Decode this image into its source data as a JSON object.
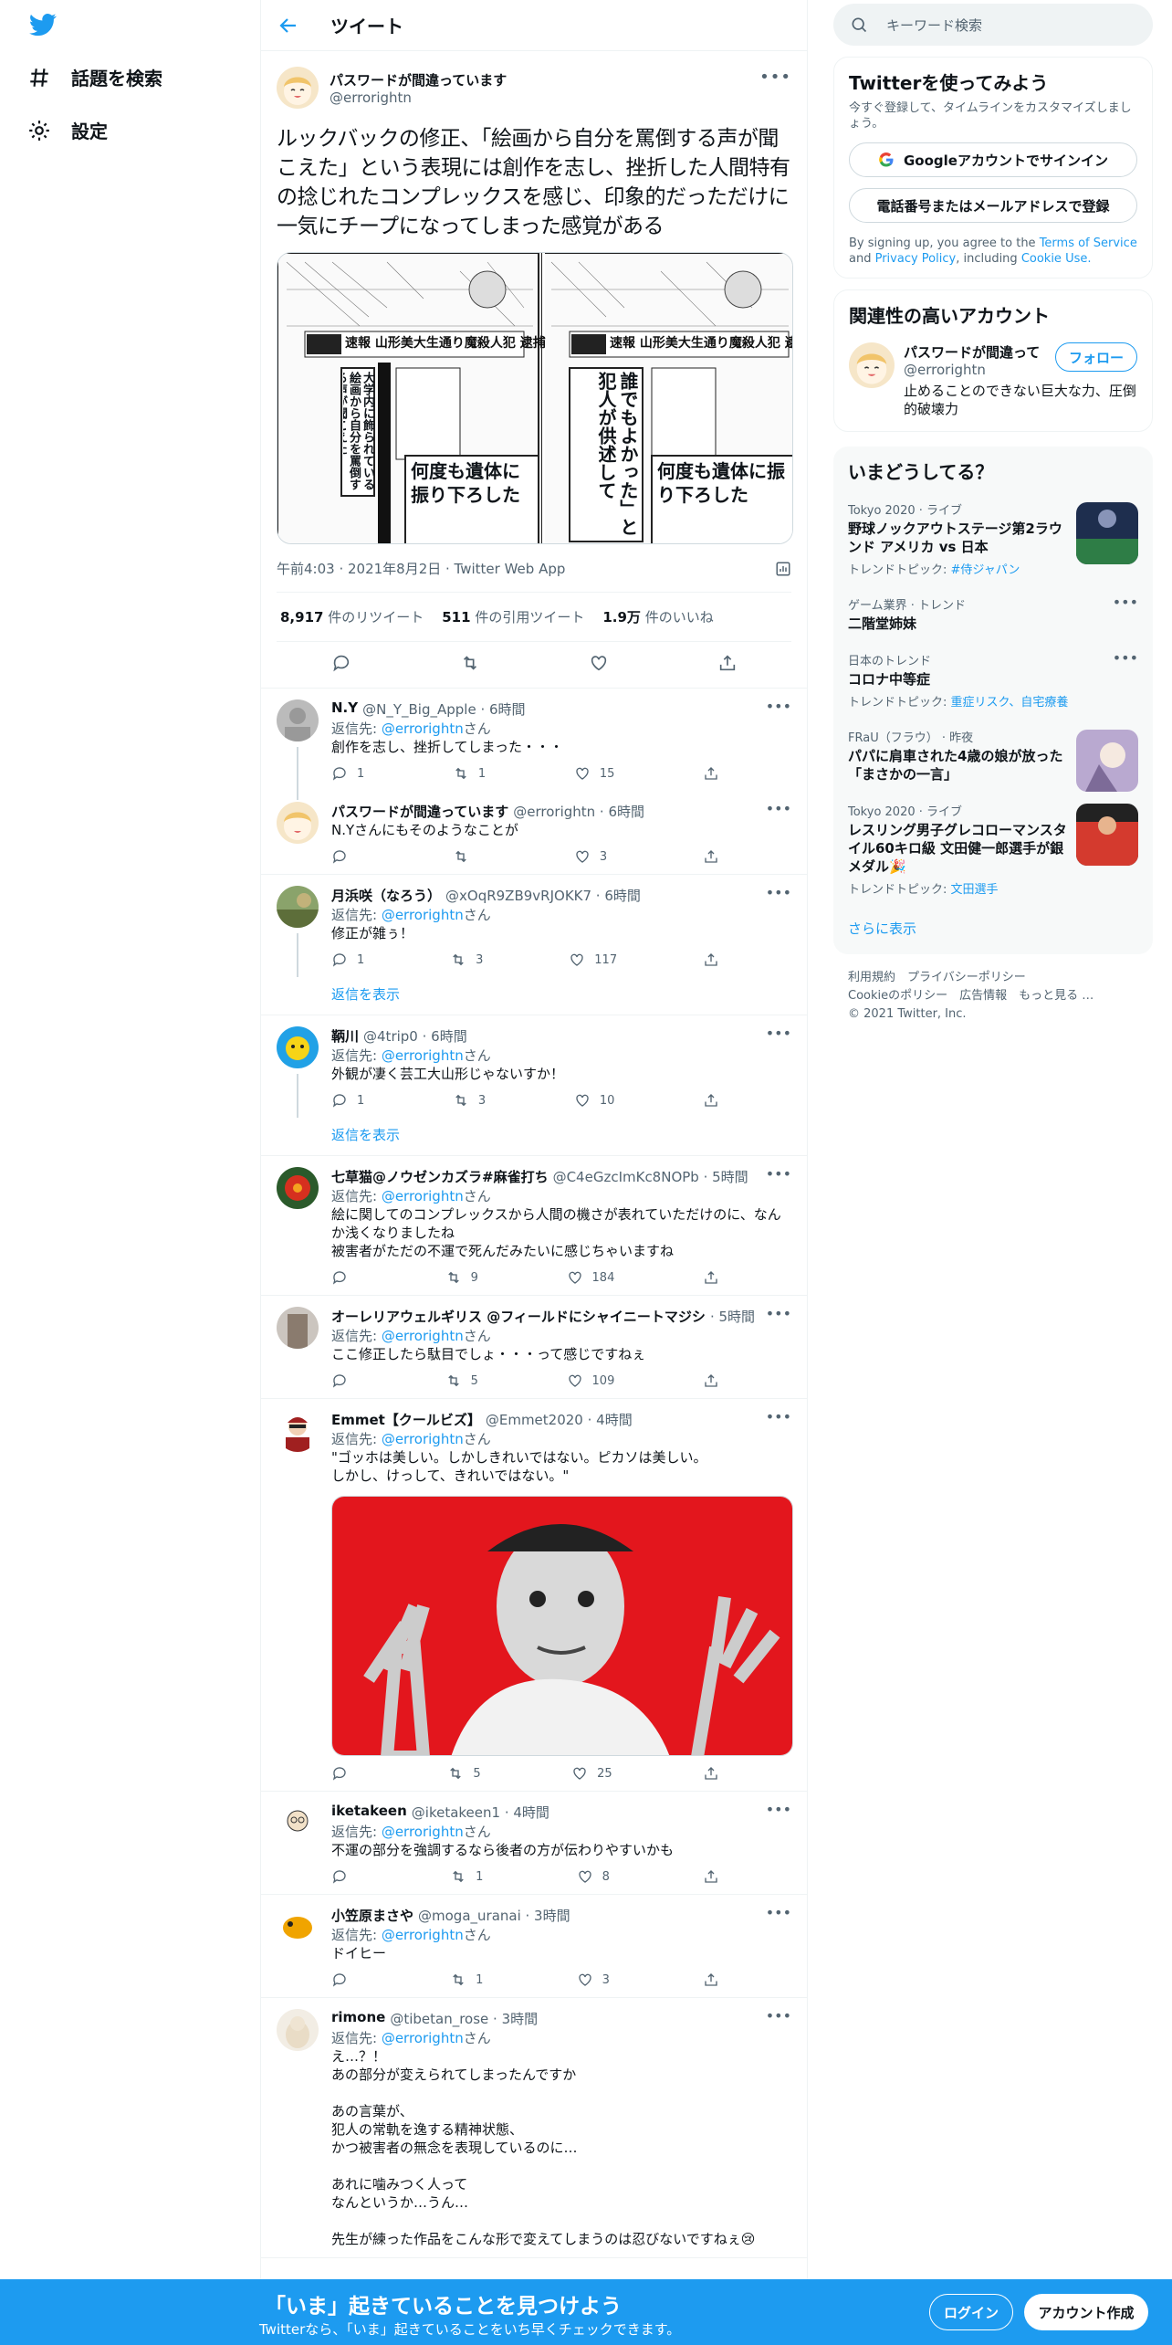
{
  "nav": {
    "explore": "話題を検索",
    "settings": "設定"
  },
  "header": {
    "title": "ツイート"
  },
  "tweet": {
    "author_name": "パスワードが間違っています",
    "author_handle": "@errorightn",
    "text": "ルックバックの修正、「絵画から自分を罵倒する声が聞こえた」という表現には創作を志し、挫折した人間特有の捻じれたコンプレックスを感じ、印象的だっただけに一気にチープになってしまった感覚がある",
    "media_caption_left": "速報 山形美大生通り魔殺人犯 逮捕",
    "media_caption_right": "速報 山形美大生通り魔殺人犯 逮捕",
    "media_quote_left": "大学内に飾られている絵画から自分を罵倒する声が聞こえた",
    "media_quote_right": "誰でもよかった」と犯人が供述して",
    "media_text_bottom": "何度も遺体に振り下ろした",
    "time": "午前4:03 · 2021年8月2日 · Twitter Web App",
    "retweets": "8,917",
    "retweets_label": "件のリツイート",
    "quotes": "511",
    "quotes_label": "件の引用ツイート",
    "likes": "1.9万",
    "likes_label": "件のいいね"
  },
  "replies": [
    {
      "name": "N.Y",
      "handle": "@N_Y_Big_Apple · 6時間",
      "reply_to": "@errorightn",
      "reply_prefix": "返信先: ",
      "reply_suffix": "さん",
      "text": "創作を志し、挫折してしまった・・・",
      "reply_count": "1",
      "rt_count": "1",
      "like_count": "15"
    },
    {
      "name": "パスワードが間違っています",
      "handle": "@errorightn · 6時間",
      "text": "N.Yさんにもそのようなことが",
      "reply_count": "",
      "rt_count": "",
      "like_count": "3"
    },
    {
      "name": "月浜咲（なろう）",
      "handle": "@xOqR9ZB9vRJOKK7 · 6時間",
      "reply_to": "@errorightn",
      "reply_prefix": "返信先: ",
      "reply_suffix": "さん",
      "text": "修正が雑ぅ！",
      "reply_count": "1",
      "rt_count": "3",
      "like_count": "117"
    },
    {
      "name": "鞆川",
      "handle": "@4trip0 · 6時間",
      "reply_to": "@errorightn",
      "reply_prefix": "返信先: ",
      "reply_suffix": "さん",
      "text": "外観が凄く芸工大山形じゃないすか！",
      "reply_count": "1",
      "rt_count": "3",
      "like_count": "10"
    },
    {
      "name": "七草猫@ノウゼンカズラ#麻雀打ち",
      "handle": "@C4eGzcImKc8NOPb · 5時間",
      "reply_to": "@errorightn",
      "reply_prefix": "返信先: ",
      "reply_suffix": "さん",
      "text": "絵に関してのコンプレックスから人間の機さが表れていただけのに、なんか浅くなりましたね\n被害者がただの不運で死んだみたいに感じちゃいますね",
      "reply_count": "",
      "rt_count": "9",
      "like_count": "184"
    },
    {
      "name": "オーレリアウェルギリス @フィールドにシャイニートマジシ",
      "handle": "· 5時間",
      "reply_to": "@errorightn",
      "reply_prefix": "返信先: ",
      "reply_suffix": "さん",
      "text": "ここ修正したら駄目でしょ・・・って感じですねぇ",
      "reply_count": "",
      "rt_count": "5",
      "like_count": "109"
    },
    {
      "name": "Emmet【クールビズ】",
      "handle": "@Emmet2020 · 4時間",
      "reply_to": "@errorightn",
      "reply_prefix": "返信先: ",
      "reply_suffix": "さん",
      "text": "\"ゴッホは美しい。しかしきれいではない。ピカソは美しい。\nしかし、けっして、きれいではない。\"",
      "reply_count": "",
      "rt_count": "5",
      "like_count": "25"
    },
    {
      "name": "iketakeen",
      "handle": "@iketakeen1 · 4時間",
      "reply_to": "@errorightn",
      "reply_prefix": "返信先: ",
      "reply_suffix": "さん",
      "text": "不運の部分を強調するなら後者の方が伝わりやすいかも",
      "reply_count": "",
      "rt_count": "1",
      "like_count": "8"
    },
    {
      "name": "小笠原まさや",
      "handle": "@moga_uranai · 3時間",
      "reply_to": "@errorightn",
      "reply_prefix": "返信先: ",
      "reply_suffix": "さん",
      "text": "ドイヒー",
      "reply_count": "",
      "rt_count": "1",
      "like_count": "3"
    },
    {
      "name": "rimone",
      "handle": "@tibetan_rose · 3時間",
      "reply_to": "@errorightn",
      "reply_prefix": "返信先: ",
      "reply_suffix": "さん",
      "text": "え…？！\nあの部分が変えられてしまったんですか\n\nあの言葉が、\n犯人の常軌を逸する精神状態、\nかつ被害者の無念を表現しているのに…\n\nあれに噛みつく人って\nなんというか…うん…\n\n先生が練った作品をこんな形で変えてしまうのは忍びないですねぇ😢"
    }
  ],
  "show_replies": "返信を表示",
  "search": {
    "placeholder": "キーワード検索"
  },
  "signup": {
    "title": "Twitterを使ってみよう",
    "sub": "今すぐ登録して、タイムラインをカスタマイズしましょう。",
    "google": "Googleアカウントでサインイン",
    "phone": "電話番号またはメールアドレスで登録",
    "fine1": "By signing up, you agree to the ",
    "terms": "Terms of Service",
    "fine2": " and ",
    "privacy": "Privacy Policy",
    "fine3": ", including ",
    "cookie": "Cookie Use."
  },
  "related": {
    "title": "関連性の高いアカウント",
    "name": "パスワードが間違って",
    "handle": "@errorightn",
    "follow": "フォロー",
    "bio": "止めることのできない巨大な力、圧倒的破壊力"
  },
  "trends": {
    "title": "いまどうしてる？",
    "items": [
      {
        "cat": "Tokyo 2020 · ライブ",
        "name": "野球ノックアウトステージ第2ラウンド アメリカ vs 日本",
        "topic_label": "トレンドトピック: ",
        "topic": "#侍ジャパン"
      },
      {
        "cat": "ゲーム業界 · トレンド",
        "name": "二階堂姉妹"
      },
      {
        "cat": "日本のトレンド",
        "name": "コロナ中等症",
        "topic_label": "トレンドトピック: ",
        "topic": "重症リスク、自宅療養"
      },
      {
        "cat": "FRaU（フラウ） · 昨夜",
        "name": "パパに肩車された4歳の娘が放った「まさかの一言」"
      },
      {
        "cat": "Tokyo 2020 · ライブ",
        "name": "レスリング男子グレコローマンスタイル60キロ級 文田健一郎選手が銀メダル🎉",
        "topic_label": "トレンドトピック: ",
        "topic": "文田選手"
      }
    ],
    "more": "さらに表示"
  },
  "footer": {
    "l1": "利用規約　プライバシーポリシー",
    "l2": "Cookieのポリシー　広告情報　もっと見る …",
    "l3": "© 2021 Twitter, Inc."
  },
  "bottom": {
    "title": "「いま」起きていることを見つけよう",
    "sub": "Twitterなら、「いま」起きていることをいち早くチェックできます。",
    "login": "ログイン",
    "signup": "アカウント作成"
  },
  "colors": {
    "accent": "#1d9bf0",
    "text": "#0f1419",
    "muted": "#536471"
  }
}
